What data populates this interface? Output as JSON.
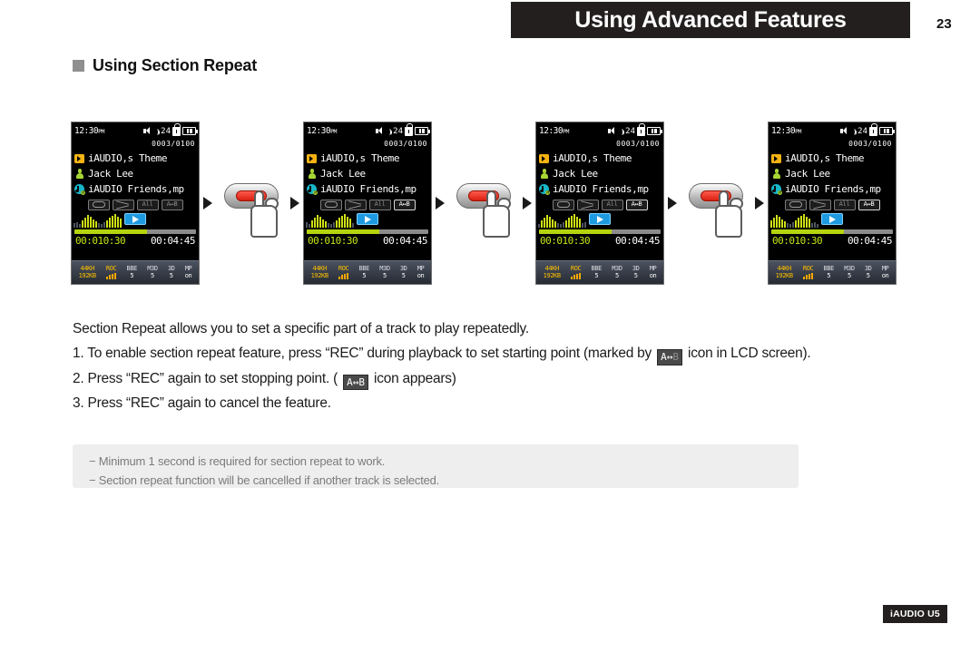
{
  "header": {
    "title": "Using Advanced Features",
    "page_number": "23"
  },
  "section": {
    "title": "Using Section Repeat"
  },
  "device_screens": [
    {
      "clock": "12:30",
      "ampm": "PM",
      "volume": "24",
      "track_counter": "0003/0100",
      "rows": [
        {
          "icon": "folder-icon",
          "label": "iAUDIO,s Theme"
        },
        {
          "icon": "artist-icon",
          "label": "Jack Lee"
        },
        {
          "icon": "music-file-icon",
          "label": "iAUDIO Friends,mp"
        }
      ],
      "modes": [
        {
          "name": "repeat-icon",
          "label": "",
          "lit": false
        },
        {
          "name": "shuffle-icon",
          "label": "",
          "lit": false
        },
        {
          "name": "repeat-all-icon",
          "label": "All",
          "lit": false
        },
        {
          "name": "section-repeat-icon",
          "label": "A↔B",
          "lit": false
        }
      ],
      "time_elapsed": "00:010:30",
      "time_total": "00:04:45",
      "footer_cells": [
        {
          "top": "44KH",
          "bottom": "192KB",
          "highlight": true
        },
        {
          "top": "ROC",
          "bottom": "bars",
          "highlight": true
        },
        {
          "top": "BBE",
          "bottom": "5",
          "highlight": false
        },
        {
          "top": "M3D",
          "bottom": "5",
          "highlight": false
        },
        {
          "top": "3D",
          "bottom": "5",
          "highlight": false
        },
        {
          "top": "MP",
          "bottom": "on",
          "highlight": false
        }
      ]
    },
    {
      "clock": "12:30",
      "ampm": "PM",
      "volume": "24",
      "track_counter": "0003/0100",
      "rows": [
        {
          "icon": "folder-icon",
          "label": "iAUDIO,s Theme"
        },
        {
          "icon": "artist-icon",
          "label": "Jack Lee"
        },
        {
          "icon": "music-file-icon",
          "label": "iAUDIO Friends,mp"
        }
      ],
      "modes": [
        {
          "name": "repeat-icon",
          "label": "",
          "lit": false
        },
        {
          "name": "shuffle-icon",
          "label": "",
          "lit": false
        },
        {
          "name": "repeat-all-icon",
          "label": "All",
          "lit": false
        },
        {
          "name": "section-repeat-icon",
          "label": "A↔B",
          "lit": true
        }
      ],
      "time_elapsed": "00:010:30",
      "time_total": "00:04:45",
      "footer_cells": [
        {
          "top": "44KH",
          "bottom": "192KB",
          "highlight": true
        },
        {
          "top": "ROC",
          "bottom": "bars",
          "highlight": true
        },
        {
          "top": "BBE",
          "bottom": "5",
          "highlight": false
        },
        {
          "top": "M3D",
          "bottom": "5",
          "highlight": false
        },
        {
          "top": "3D",
          "bottom": "5",
          "highlight": false
        },
        {
          "top": "MP",
          "bottom": "on",
          "highlight": false
        }
      ]
    },
    {
      "clock": "12:30",
      "ampm": "PM",
      "volume": "24",
      "track_counter": "0003/0100",
      "rows": [
        {
          "icon": "folder-icon",
          "label": "iAUDIO,s Theme"
        },
        {
          "icon": "artist-icon",
          "label": "Jack Lee"
        },
        {
          "icon": "music-file-icon",
          "label": "iAUDIO Friends,mp"
        }
      ],
      "modes": [
        {
          "name": "repeat-icon",
          "label": "",
          "lit": false
        },
        {
          "name": "shuffle-icon",
          "label": "",
          "lit": false
        },
        {
          "name": "repeat-all-icon",
          "label": "All",
          "lit": false
        },
        {
          "name": "section-repeat-icon",
          "label": "A↔B",
          "lit": true
        }
      ],
      "time_elapsed": "00:010:30",
      "time_total": "00:04:45",
      "footer_cells": [
        {
          "top": "44KH",
          "bottom": "192KB",
          "highlight": true
        },
        {
          "top": "ROC",
          "bottom": "bars",
          "highlight": true
        },
        {
          "top": "BBE",
          "bottom": "5",
          "highlight": false
        },
        {
          "top": "M3D",
          "bottom": "5",
          "highlight": false
        },
        {
          "top": "3D",
          "bottom": "5",
          "highlight": false
        },
        {
          "top": "MP",
          "bottom": "on",
          "highlight": false
        }
      ]
    },
    {
      "clock": "12:30",
      "ampm": "PM",
      "volume": "24",
      "track_counter": "0003/0100",
      "rows": [
        {
          "icon": "folder-icon",
          "label": "iAUDIO,s Theme"
        },
        {
          "icon": "artist-icon",
          "label": "Jack Lee"
        },
        {
          "icon": "music-file-icon",
          "label": "iAUDIO Friends,mp"
        }
      ],
      "modes": [
        {
          "name": "repeat-icon",
          "label": "",
          "lit": false
        },
        {
          "name": "shuffle-icon",
          "label": "",
          "lit": false
        },
        {
          "name": "repeat-all-icon",
          "label": "All",
          "lit": false
        },
        {
          "name": "section-repeat-icon",
          "label": "A↔B",
          "lit": true
        }
      ],
      "time_elapsed": "00:010:30",
      "time_total": "00:04:45",
      "footer_cells": [
        {
          "top": "44KH",
          "bottom": "192KB",
          "highlight": true
        },
        {
          "top": "ROC",
          "bottom": "bars",
          "highlight": true
        },
        {
          "top": "BBE",
          "bottom": "5",
          "highlight": false
        },
        {
          "top": "M3D",
          "bottom": "5",
          "highlight": false
        },
        {
          "top": "3D",
          "bottom": "5",
          "highlight": false
        },
        {
          "top": "MP",
          "bottom": "on",
          "highlight": false
        }
      ]
    }
  ],
  "rec_button": {
    "name": "rec-button",
    "hand_hint": "finger pressing REC"
  },
  "body": {
    "intro": "Section Repeat allows you to set a specific part of a track to play repeatedly.",
    "step1_pre": "1. To enable section repeat feature, press “REC” during playback to set starting point (marked by",
    "step1_icon_a": "A",
    "step1_icon_arrow": "↔",
    "step1_icon_b": "B",
    "step1_post": "icon in LCD screen).",
    "step2_pre": "2. Press “REC” again to set stopping point. (",
    "step2_icon_a": "A",
    "step2_icon_arrow": "↔",
    "step2_icon_b": "B",
    "step2_post": "icon appears)",
    "step3": "3. Press “REC” again to cancel the feature."
  },
  "notes": [
    "− Minimum 1 second is required for section repeat to work.",
    "− Section repeat function will be cancelled if another track is selected."
  ],
  "footer": {
    "product": "iAUDIO U5"
  },
  "colors": {
    "header_bg": "#231f1f",
    "note_bg": "#eeeeee",
    "lcd_accent": "#c4e817",
    "play_blue": "#1e9ae0",
    "rec_red": "#d81f10"
  }
}
